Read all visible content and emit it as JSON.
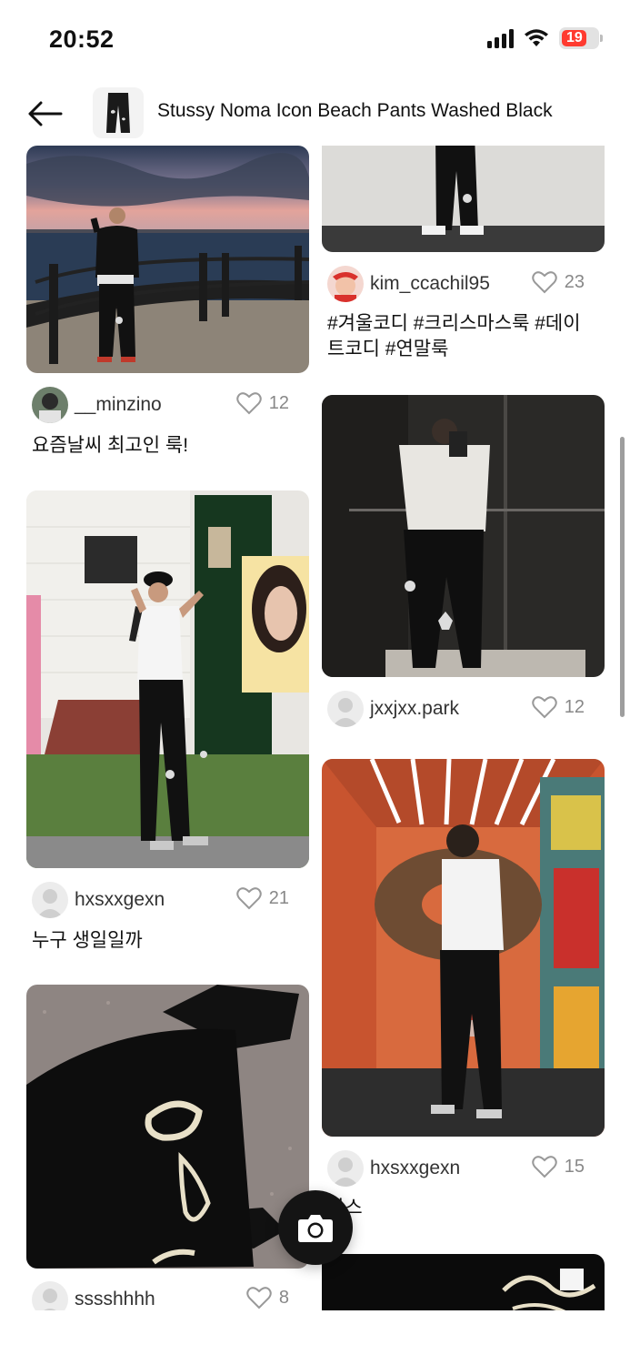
{
  "status_bar": {
    "time": "20:52",
    "battery_level": "19",
    "battery_color": "#ff3b30"
  },
  "header": {
    "back_icon": "arrow-left-icon",
    "product_title": "Stussy Noma Icon Beach Pants Washed Black"
  },
  "posts": {
    "left": [
      {
        "username": "__minzino",
        "likes": "12",
        "caption": "요즘날씨 최고인 룩!",
        "photo": "Man at seaside railing at dusk, black sweatshirt and black pants"
      },
      {
        "username": "hxsxxgexn",
        "likes": "21",
        "caption": "누구 생일일까",
        "photo": "Man in cap posing in front of cafe with poster"
      },
      {
        "username": "sssshhhh",
        "likes": "8",
        "caption": "",
        "photo": "Close-up of black pants with cream embroidery and black shoes"
      }
    ],
    "right": [
      {
        "username": "kim_ccachil95",
        "likes": "23",
        "caption": "#겨울코디 #크리스마스룩 #데이트코디 #연말룩",
        "photo": "Legs in black pants and white sneakers against wall"
      },
      {
        "username": "jxxjxx.park",
        "likes": "12",
        "caption": "",
        "photo": "Elevator mirror selfie, white tee and black pants"
      },
      {
        "username": "hxsxxgexn",
        "likes": "15",
        "caption": "나스",
        "photo": "Man with shopping bag in orange donut-themed elevator"
      },
      {
        "username": "",
        "likes": "",
        "caption": "",
        "photo": "Black pants embroidery close-up"
      }
    ]
  },
  "fab": {
    "icon": "camera-icon"
  }
}
